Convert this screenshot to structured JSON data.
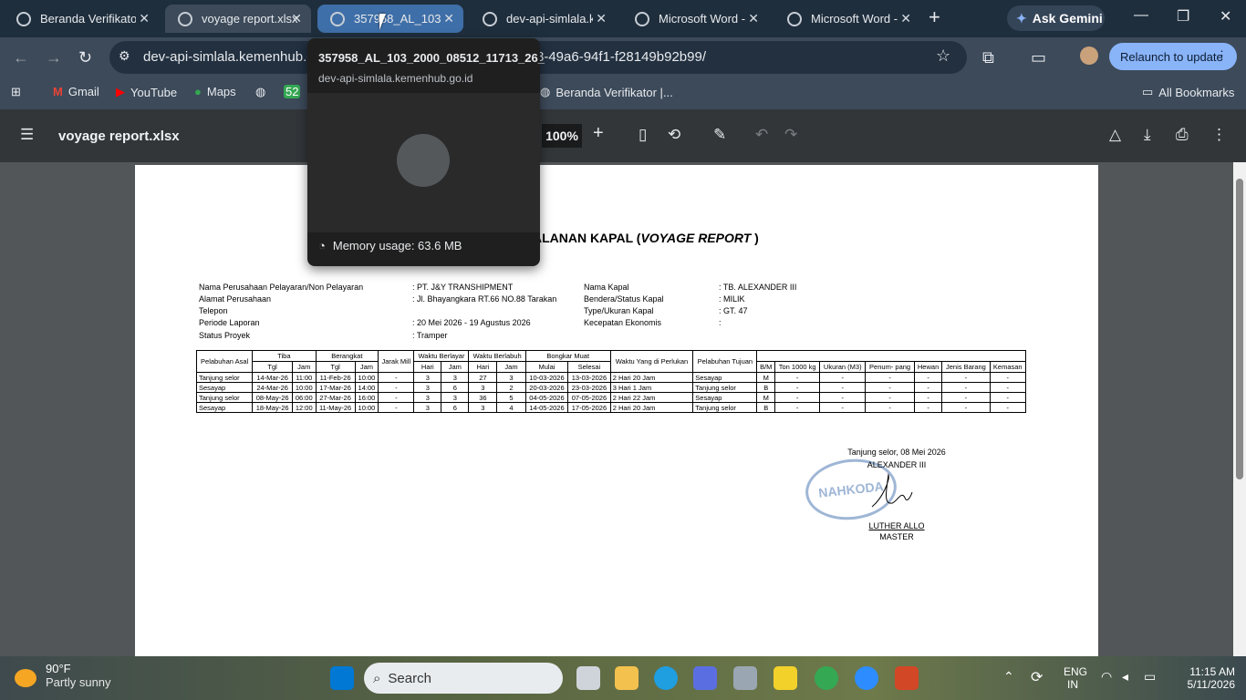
{
  "browser": {
    "tabs": [
      {
        "label": "Beranda Verifikator",
        "state": "normal"
      },
      {
        "label": "voyage report.xlsx",
        "state": "active"
      },
      {
        "label": "357958_AL_103_2000",
        "state": "hover"
      },
      {
        "label": "dev-api-simlala.ke",
        "state": "normal"
      },
      {
        "label": "Microsoft Word -",
        "state": "normal"
      },
      {
        "label": "Microsoft Word -",
        "state": "normal"
      }
    ],
    "ask_gemini": "Ask Gemini",
    "url_left": "dev-api-simlala.kemenhub.go",
    "url_right": "8-49a6-94f1-f28149b92b99/",
    "relaunch": "Relaunch to update",
    "bookmarks": [
      "Gmail",
      "YouTube",
      "Maps",
      "Beranda Verifikator |..."
    ],
    "bookmark_badge": "52",
    "all_bookmarks": "All Bookmarks"
  },
  "tab_preview": {
    "title": "357958_AL_103_2000_08512_11713_26_",
    "domain": "dev-api-simlala.kemenhub.go.id",
    "memory": "Memory usage: 63.6 MB"
  },
  "pdf": {
    "title": "voyage report.xlsx",
    "zoom": "100%"
  },
  "report": {
    "title_plain": "ASI PERJALANAN KAPAL (",
    "title_italic": "VOYAGE REPORT",
    "title_end": " )",
    "info_left": [
      {
        "label": "Nama Perusahaan Pelayaran/Non Pelayaran",
        "value": ":  PT. J&Y TRANSHIPMENT"
      },
      {
        "label": "Alamat Perusahaan",
        "value": ":  Jl. Bhayangkara RT.66 NO.88 Tarakan"
      },
      {
        "label": "Telepon",
        "value": ""
      },
      {
        "label": "Periode Laporan",
        "value": ":  20 Mei 2026 - 19 Agustus 2026"
      },
      {
        "label": "Status Proyek",
        "value": ":  Tramper"
      }
    ],
    "info_right": [
      {
        "label": "Nama Kapal",
        "value": ": TB. ALEXANDER III"
      },
      {
        "label": "Bendera/Status Kapal",
        "value": ":  MILIK"
      },
      {
        "label": "Type/Ukuran Kapal",
        "value": ":  GT. 47"
      },
      {
        "label": "Kecepatan Ekonomis",
        "value": ":"
      }
    ],
    "headers": {
      "pelabuhan_asal": "Pelabuhan Asal",
      "tiba": "Tiba",
      "berangkat": "Berangkat",
      "jarak": "Jarak Mill",
      "waktu_berlayar": "Waktu Berlayar",
      "waktu_berlabuh": "Waktu Berlabuh",
      "bongkar_muat": "Bongkar Muat",
      "waktu_perlukan": "Waktu Yang di Perlukan",
      "pelabuhan_tujuan": "Pelabuhan Tujuan",
      "tgl": "Tgl",
      "jam": "Jam",
      "hari": "Hari",
      "mulai": "Mulai",
      "selesai": "Selesai",
      "bm": "B/M",
      "ton": "Ton 1000 kg",
      "ukuran": "Ukuran (M3)",
      "penumpang": "Penum- pang",
      "hewan": "Hewan",
      "jenis_barang": "Jenis Barang",
      "kemasan": "Kemasan"
    },
    "rows": [
      [
        "Tanjung selor",
        "14-Mar-26",
        "11:00",
        "11-Feb-26",
        "10:00",
        "-",
        "3",
        "3",
        "27",
        "3",
        "10-03-2026",
        "13-03-2026",
        "2 Hari 20 Jam",
        "Sesayap",
        "M",
        "-",
        "-",
        "-",
        "-",
        "-",
        "-"
      ],
      [
        "Sesayap",
        "24-Mar-26",
        "10:00",
        "17-Mar-26",
        "14:00",
        "-",
        "3",
        "6",
        "3",
        "2",
        "20-03-2026",
        "23-03-2026",
        "3 Hari 1 Jam",
        "Tanjung selor",
        "B",
        "-",
        "-",
        "-",
        "-",
        "-",
        "-"
      ],
      [
        "Tanjung selor",
        "08-May-26",
        "06:00",
        "27-Mar-26",
        "16:00",
        "-",
        "3",
        "3",
        "36",
        "5",
        "04-05-2026",
        "07-05-2026",
        "2 Hari 22 Jam",
        "Sesayap",
        "M",
        "-",
        "-",
        "-",
        "-",
        "-",
        "-"
      ],
      [
        "Sesayap",
        "18-May-26",
        "12:00",
        "11-May-26",
        "10:00",
        "-",
        "3",
        "6",
        "3",
        "4",
        "14-05-2026",
        "17-05-2026",
        "2 Hari 20 Jam",
        "Tanjung selor",
        "B",
        "-",
        "-",
        "-",
        "-",
        "-",
        "-"
      ]
    ],
    "sign_place": "Tanjung selor, 08 Mei 2026",
    "sign_ship": "ALEXANDER III",
    "sign_name": "LUTHER ALLO",
    "sign_role": "MASTER",
    "stamp_text": "NAHKODA"
  },
  "taskbar": {
    "temp": "90°F",
    "weather": "Partly sunny",
    "search": "Search",
    "lang1": "ENG",
    "lang2": "IN",
    "time": "11:15 AM",
    "date": "5/11/2026"
  }
}
